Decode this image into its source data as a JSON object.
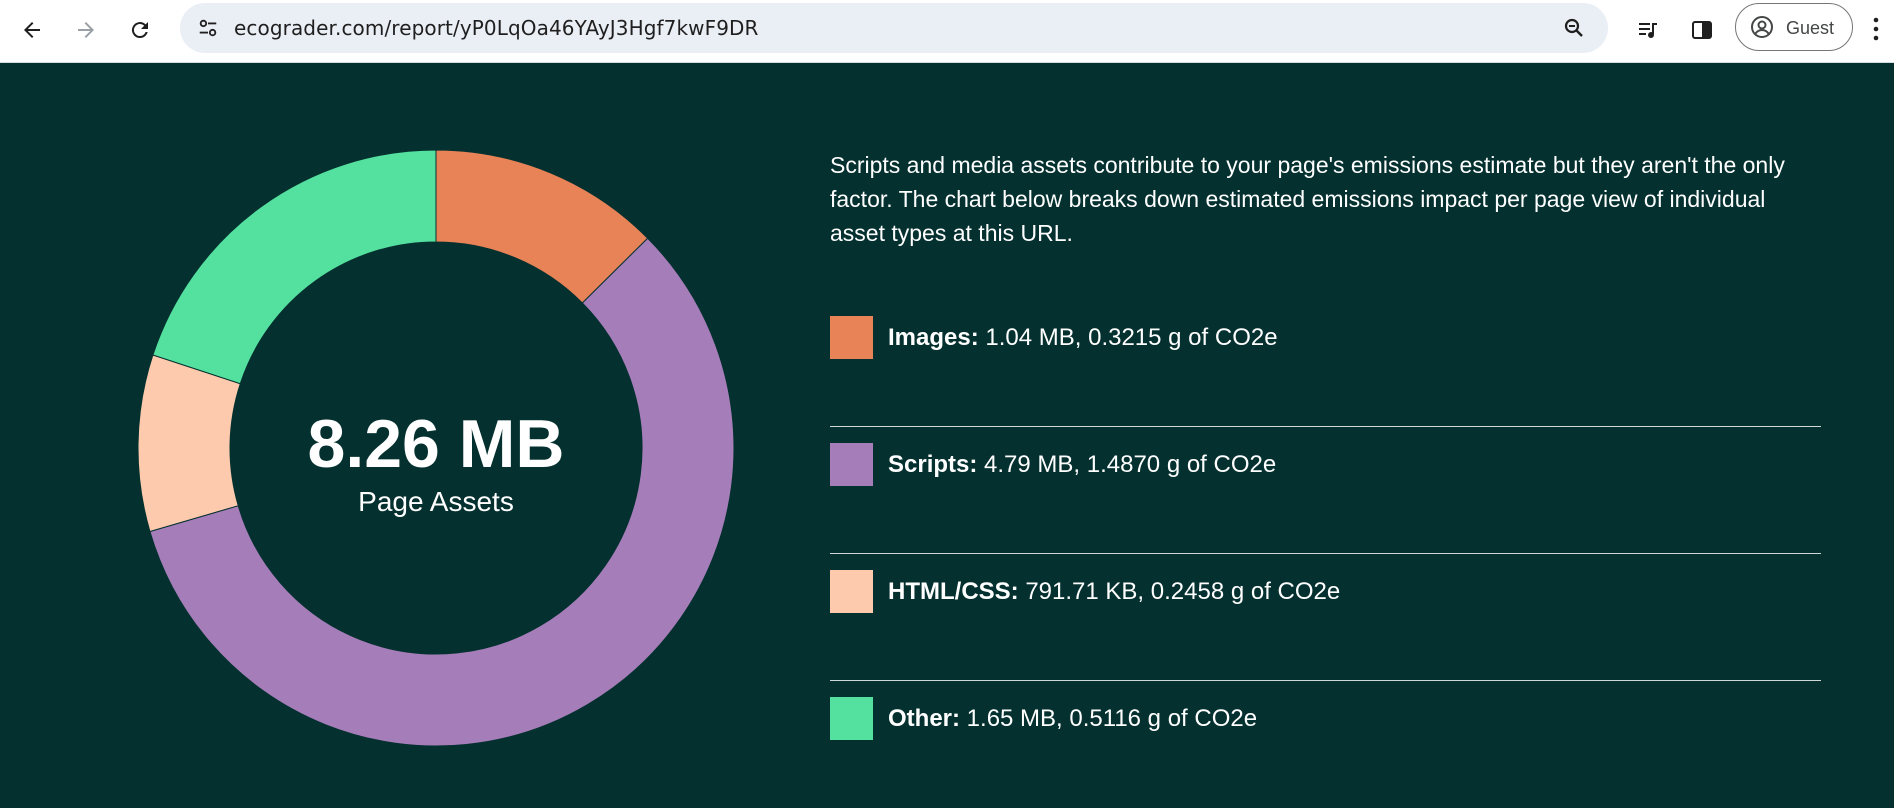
{
  "browser": {
    "url": "ecograder.com/report/yP0LqOa46YAyJ3Hgf7kwF9DR",
    "profile_label": "Guest",
    "icons": [
      "back-arrow-icon",
      "forward-arrow-icon",
      "reload-icon",
      "site-settings-icon",
      "zoom-icon",
      "media-control-icon",
      "side-panel-icon",
      "account-icon",
      "more-menu-icon"
    ]
  },
  "summary": {
    "total_size": "8.26 MB",
    "total_label": "Page Assets"
  },
  "intro_text": "Scripts and media assets contribute to your page's emissions estimate but they aren't the only factor. The chart below breaks down estimated emissions impact per page view of individual asset types at this URL.",
  "legend": [
    {
      "label": "Images:",
      "detail": "1.04 MB, 0.3215 g of CO2e",
      "color": "#e88257"
    },
    {
      "label": "Scripts:",
      "detail": "4.79 MB, 1.4870 g of CO2e",
      "color": "#a57db9"
    },
    {
      "label": "HTML/CSS:",
      "detail": "791.71 KB, 0.2458 g of CO2e",
      "color": "#fdcaad"
    },
    {
      "label": "Other:",
      "detail": "1.65 MB, 0.5116 g of CO2e",
      "color": "#54e19f"
    }
  ],
  "chart_data": {
    "type": "pie",
    "categories": [
      "Images",
      "Scripts",
      "HTML/CSS",
      "Other"
    ],
    "values": [
      1.04,
      4.79,
      0.79171,
      1.65
    ],
    "colors": [
      "#e88257",
      "#a57db9",
      "#fdcaad",
      "#54e19f"
    ],
    "donut": true
  }
}
